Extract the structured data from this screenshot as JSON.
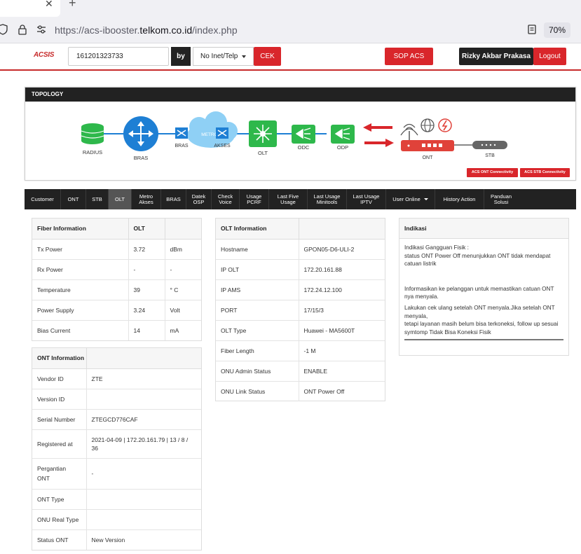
{
  "browser": {
    "tab_close_glyph": "✕",
    "new_tab_glyph": "+",
    "url_prefix": "https://acs-ibooster.",
    "url_domain": "telkom.co.id",
    "url_suffix": "/index.php",
    "zoom": "70%"
  },
  "header": {
    "logo": "ACSIS",
    "search_value": "161201323733",
    "by_label": "by",
    "search_type": "No Inet/Telp",
    "cek_label": "CEK",
    "sop_label": "SOP ACS",
    "user_name": "Rizky Akbar Prakasa",
    "logout_label": "Logout"
  },
  "topology": {
    "title": "TOPOLOGY",
    "nodes": {
      "radius": "RADIUS",
      "bras": "BRAS",
      "metro": "METRO - E",
      "metro_bras": "BRAS",
      "metro_akses": "AKSES",
      "olt": "OLT",
      "odc": "ODC",
      "odp": "ODP",
      "ont": "ONT",
      "stb": "STB"
    },
    "btn_ont": "ACS ONT Connectivity",
    "btn_stb": "ACS STB Connectivity"
  },
  "nav": [
    {
      "label": "Customer"
    },
    {
      "label": "ONT"
    },
    {
      "label": "STB"
    },
    {
      "label": "OLT"
    },
    {
      "label": "Metro\nAkses"
    },
    {
      "label": "BRAS"
    },
    {
      "label": "Datek\nOSP"
    },
    {
      "label": "Check\nVoice"
    },
    {
      "label": "Usage\nPCRF"
    },
    {
      "label": "Last Five\nUsage"
    },
    {
      "label": "Last Usage\nMinitools"
    },
    {
      "label": "Last Usage\nIPTV"
    },
    {
      "label": "User Online"
    },
    {
      "label": "History Action"
    },
    {
      "label": "Panduan\nSolusi"
    }
  ],
  "fiber": {
    "header": [
      "Fiber Information",
      "OLT",
      ""
    ],
    "rows": [
      [
        "Tx Power",
        "3.72",
        "dBm"
      ],
      [
        "Rx Power",
        "-",
        "-"
      ],
      [
        "Temperature",
        "39",
        "° C"
      ],
      [
        "Power Supply",
        "3.24",
        "Volt"
      ],
      [
        "Bias Current",
        "14",
        "mA"
      ]
    ]
  },
  "ont_info": {
    "header": [
      "ONT Information",
      ""
    ],
    "rows": [
      [
        "Vendor ID",
        "ZTE"
      ],
      [
        "Version ID",
        ""
      ],
      [
        "Serial Number",
        "ZTEGCD776CAF"
      ],
      [
        "Registered at",
        "2021-04-09 | 172.20.161.79 | 13 / 8 / 36"
      ],
      [
        "Pergantian ONT",
        "-"
      ],
      [
        "ONT Type",
        ""
      ],
      [
        "ONU Real Type",
        ""
      ],
      [
        "Status ONT",
        "New Version"
      ]
    ]
  },
  "olt_info": {
    "header": [
      "OLT Information",
      ""
    ],
    "rows": [
      [
        "Hostname",
        "GPON05-D6-ULI-2"
      ],
      [
        "IP OLT",
        "172.20.161.88"
      ],
      [
        "IP AMS",
        "172.24.12.100"
      ],
      [
        "PORT",
        "17/15/3"
      ],
      [
        "OLT Type",
        "Huawei - MA5600T"
      ],
      [
        "Fiber Length",
        "-1 M"
      ],
      [
        "ONU Admin Status",
        "ENABLE"
      ],
      [
        "ONU Link Status",
        "ONT Power Off"
      ]
    ]
  },
  "indikasi": {
    "title": "Indikasi",
    "p1": "Indikasi Gangguan Fisik :",
    "p2": "status ONT Power Off menunjukkan ONT tidak mendapat catuan listrik",
    "p3": "Informasikan ke pelanggan untuk memastikan catuan ONT nya menyala.",
    "p4": "Lakukan cek ulang setelah ONT menyala.Jika setelah ONT menyala,",
    "p5": "tetapi layanan masih belum bisa terkoneksi, follow up sesuai symtomp Tidak Bisa Koneksi Fisik"
  },
  "colors": {
    "brand_red": "#d9262b",
    "dark": "#222222",
    "node_green": "#2eb84b",
    "node_blue": "#1e7fd4",
    "cloud_blue": "#8fd0f5",
    "ont_red": "#e0423a"
  }
}
